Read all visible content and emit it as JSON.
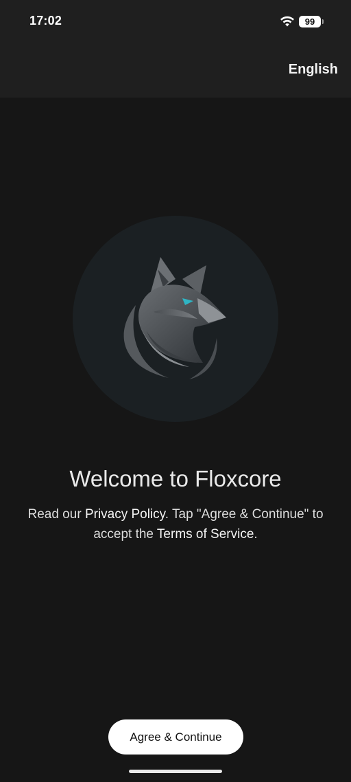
{
  "status_bar": {
    "time": "17:02",
    "battery": "99"
  },
  "header": {
    "language_label": "English"
  },
  "welcome": {
    "title": "Welcome to Floxcore",
    "text_1": "Read our ",
    "privacy_link": "Privacy Policy",
    "text_2": ". Tap \"Agree & Continue\" to accept the ",
    "terms_link": "Terms of Service",
    "text_3": "."
  },
  "actions": {
    "agree_label": "Agree & Continue"
  },
  "logo": {
    "icon": "fox-logo-icon",
    "accent_eye": "#2fb5c4"
  },
  "colors": {
    "background": "#161616",
    "header_background": "#1f1f1f",
    "button_background": "#ffffff",
    "logo_circle": "#1b2023"
  }
}
